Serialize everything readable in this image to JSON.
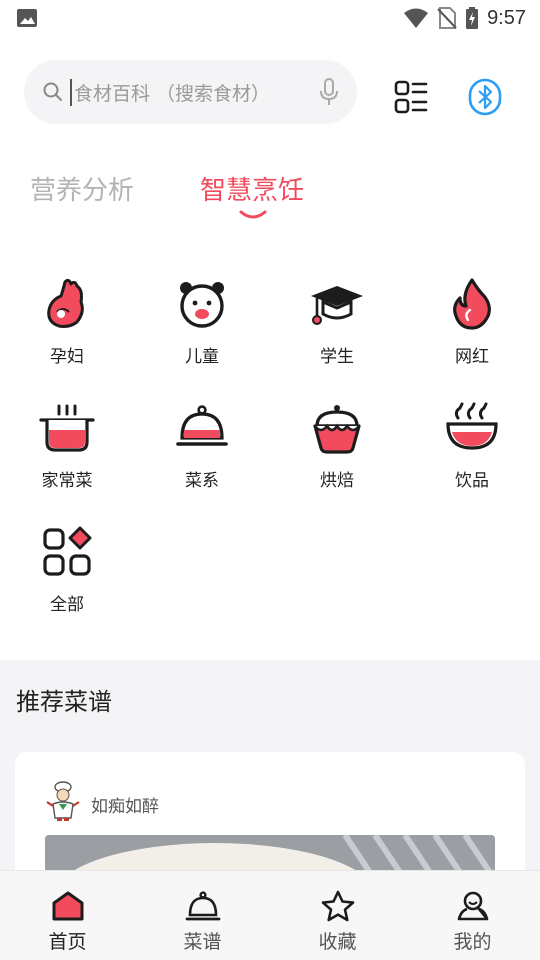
{
  "status_bar": {
    "time": "9:57",
    "icons": [
      "image-icon",
      "wifi-icon",
      "no-sim-icon",
      "battery-charging-icon"
    ]
  },
  "search": {
    "placeholder": "食材百科 （搜索食材）",
    "icons": [
      "search-icon",
      "mic-icon"
    ]
  },
  "header_actions": [
    "scan-icon",
    "bluetooth-icon"
  ],
  "tabs": [
    {
      "label": "营养分析",
      "active": false
    },
    {
      "label": "智慧烹饪",
      "active": true
    }
  ],
  "categories": [
    {
      "label": "孕妇",
      "icon": "pregnant-icon"
    },
    {
      "label": "儿童",
      "icon": "bear-face-icon"
    },
    {
      "label": "学生",
      "icon": "graduation-cap-icon"
    },
    {
      "label": "网红",
      "icon": "flame-icon"
    },
    {
      "label": "家常菜",
      "icon": "pot-icon"
    },
    {
      "label": "菜系",
      "icon": "cloche-icon"
    },
    {
      "label": "烘焙",
      "icon": "cupcake-icon"
    },
    {
      "label": "饮品",
      "icon": "hot-drink-bowl-icon"
    },
    {
      "label": "全部",
      "icon": "grid-all-icon"
    }
  ],
  "recommend": {
    "title": "推荐菜谱",
    "card": {
      "author": "如痴如醉"
    }
  },
  "bottom_nav": [
    {
      "label": "首页",
      "icon": "home-icon",
      "active": true
    },
    {
      "label": "菜谱",
      "icon": "cloche-icon",
      "active": false
    },
    {
      "label": "收藏",
      "icon": "star-icon",
      "active": false
    },
    {
      "label": "我的",
      "icon": "user-icon",
      "active": false
    }
  ],
  "colors": {
    "accent": "#f24b5e",
    "dark": "#1c1c1c",
    "bluetooth": "#2a9df4",
    "inactive_tab": "#b3b3b3",
    "section_bg": "#f4f4f6"
  }
}
